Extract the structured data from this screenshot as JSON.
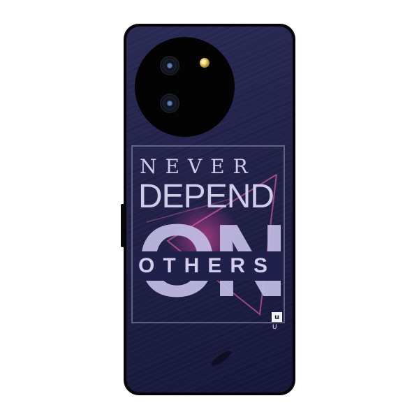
{
  "product": {
    "poster": {
      "line1": "NEVER",
      "line2": "DEPEND",
      "line3": "ON",
      "line4": "OTHERS"
    },
    "brand_mark": {
      "letter": "u",
      "sub": "U"
    }
  },
  "colors": {
    "case_background": "#22224a",
    "text": "#cfcbe8",
    "accent_glow": "#ff50aa"
  }
}
